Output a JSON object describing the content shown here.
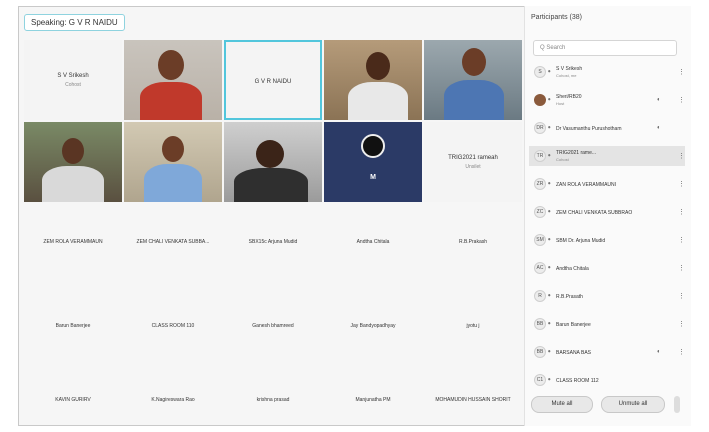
{
  "speaker": "Speaking: G V R NAIDU",
  "video_row1": [
    {
      "name": "S V Srikesh",
      "sub": "Cohost",
      "type": "name"
    },
    {
      "type": "video",
      "variant": "a"
    },
    {
      "name": "G V R NAIDU",
      "type": "name",
      "active": true
    },
    {
      "type": "video",
      "variant": "b"
    },
    {
      "type": "video",
      "variant": "c"
    }
  ],
  "video_row2": [
    {
      "type": "video",
      "variant": "d"
    },
    {
      "type": "video",
      "variant": "e"
    },
    {
      "type": "video",
      "variant": "f"
    },
    {
      "type": "obs",
      "label": "M"
    },
    {
      "name": "TRIG2021 rameah",
      "sub": "Unsilet",
      "type": "name"
    }
  ],
  "name_rows": [
    [
      "ZEM ROLA VERAMMAUN",
      "ZEM CHALI VENKATA SUBBA...",
      "SBX15c Arjuna Mudid",
      "Andtha Chitala",
      "R.B.Prakash"
    ],
    [
      "Barun Banerjee",
      "CLASS ROOM 110",
      "Ganesh bhamreed",
      "Jay Bandyopadhyay",
      "jyotu j"
    ],
    [
      "KAVIN GURIRV",
      "K.Nagireswara Rao",
      "krishna prasad",
      "Manjunatha PM",
      "MOHAMUDIN HUSSAIN SHORIT"
    ]
  ],
  "panel": {
    "title": "Participants (38)",
    "search_placeholder": "Q Search",
    "participants": [
      {
        "avatar": "S",
        "name": "S V Srikesh",
        "role": "Cohost, me",
        "cam": "",
        "more": "⋮"
      },
      {
        "avatar": "",
        "photo": true,
        "name": "Sheri/RB20",
        "role": "Host",
        "cam": "◐",
        "more": "⋮"
      },
      {
        "avatar": "DR",
        "name": "Dr Vasumanthu Purushotham",
        "role": "",
        "cam": "◐",
        "more": ""
      },
      {
        "avatar": "TR",
        "name": "TRIG2021 rame...",
        "role": "Cohost",
        "cam": "",
        "more": "⋮",
        "selected": true
      },
      {
        "avatar": "ZR",
        "name": "ZAN ROLA VERAMMAUNI",
        "role": "",
        "cam": "",
        "more": "⋮"
      },
      {
        "avatar": "ZC",
        "name": "ZEM CHALI VENKATA SUBBRAO",
        "role": "",
        "cam": "",
        "more": "⋮"
      },
      {
        "avatar": "SM",
        "name": "SBM Dr. Arjuna Mudid",
        "role": "",
        "cam": "",
        "more": "⋮"
      },
      {
        "avatar": "AC",
        "name": "Andtha Chitala",
        "role": "",
        "cam": "",
        "more": "⋮"
      },
      {
        "avatar": "R",
        "name": "R.B.Prasath",
        "role": "",
        "cam": "",
        "more": "⋮"
      },
      {
        "avatar": "BB",
        "name": "Barun Banerjee",
        "role": "",
        "cam": "",
        "more": "⋮"
      },
      {
        "avatar": "BB",
        "name": "BARSANA BAS",
        "role": "",
        "cam": "◐",
        "more": "⋮"
      },
      {
        "avatar": "C1",
        "name": "CLASS ROOM 112",
        "role": "",
        "cam": "",
        "more": ""
      }
    ],
    "mute_all": "Mute all",
    "unmute_all": "Unmute all"
  }
}
